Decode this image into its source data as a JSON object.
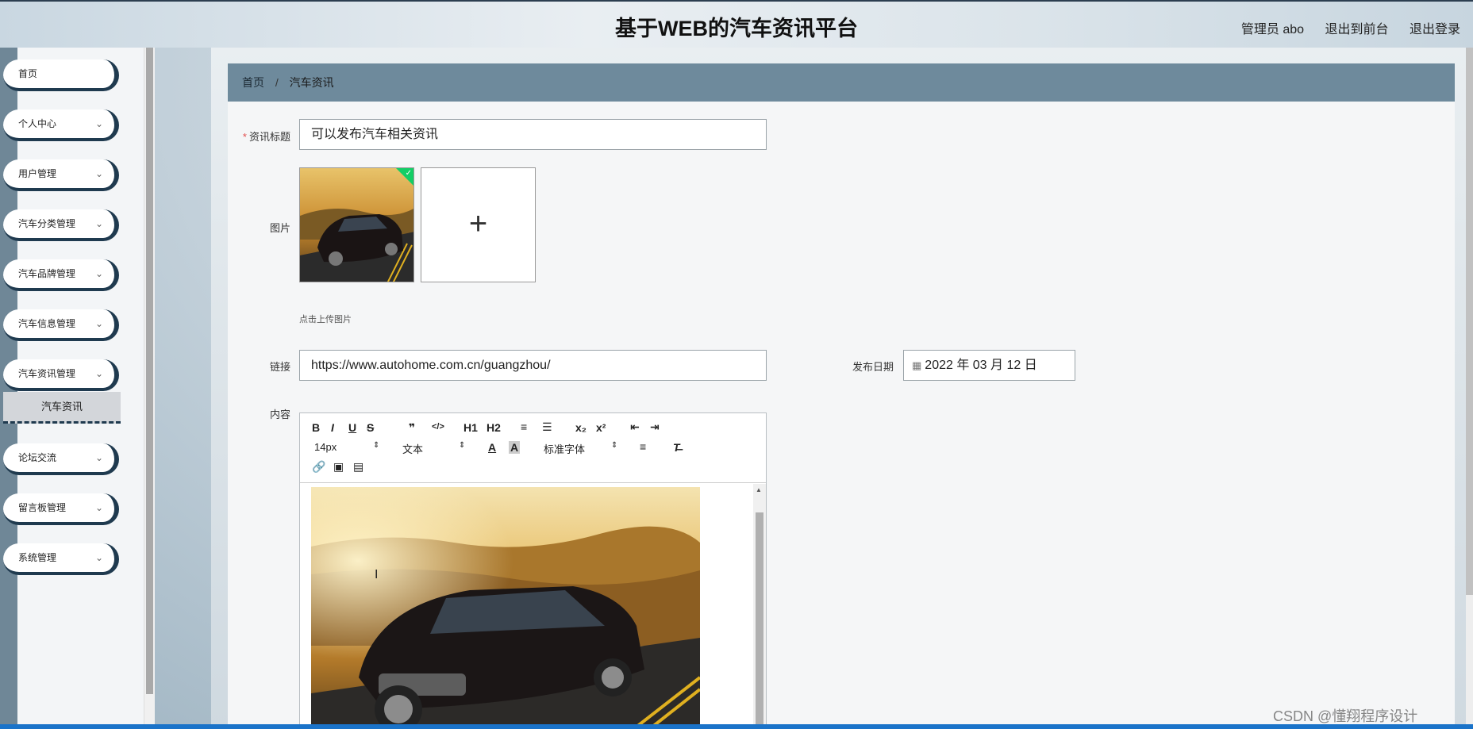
{
  "header": {
    "title": "基于WEB的汽车资讯平台",
    "user_label": "管理员 abo",
    "exit_front": "退出到前台",
    "logout": "退出登录"
  },
  "sidebar": {
    "items": [
      {
        "label": "首页",
        "has_children": false
      },
      {
        "label": "个人中心",
        "has_children": true
      },
      {
        "label": "用户管理",
        "has_children": true
      },
      {
        "label": "汽车分类管理",
        "has_children": true
      },
      {
        "label": "汽车品牌管理",
        "has_children": true
      },
      {
        "label": "汽车信息管理",
        "has_children": true
      },
      {
        "label": "汽车资讯管理",
        "has_children": true
      },
      {
        "label": "论坛交流",
        "has_children": true
      },
      {
        "label": "留言板管理",
        "has_children": true
      },
      {
        "label": "系统管理",
        "has_children": true
      }
    ],
    "active_submenu": "汽车资讯"
  },
  "breadcrumb": {
    "home": "首页",
    "separator": "/",
    "current": "汽车资讯"
  },
  "form": {
    "title_label": "资讯标题",
    "title_value": "可以发布汽车相关资讯",
    "image_label": "图片",
    "upload_hint": "点击上传图片",
    "upload_plus": "+",
    "link_label": "链接",
    "link_value": "https://www.autohome.com.cn/guangzhou/",
    "date_label": "发布日期",
    "date_value": "2022 年 03 月 12 日",
    "content_label": "内容"
  },
  "editor": {
    "font_size": "14px",
    "text_style": "文本",
    "font_family": "标准字体",
    "buttons": [
      "B",
      "I",
      "U",
      "S",
      "❞",
      "</>",
      "H1",
      "H2",
      "≡",
      "☰",
      "x₂",
      "x²",
      "⇤",
      "⇥"
    ]
  },
  "watermark": "CSDN @懂翔程序设计",
  "colors": {
    "accent": "#1f3a4f",
    "breadcrumb_bg": "#6e8a9c",
    "required": "#e24c4c",
    "success": "#13ce66"
  }
}
